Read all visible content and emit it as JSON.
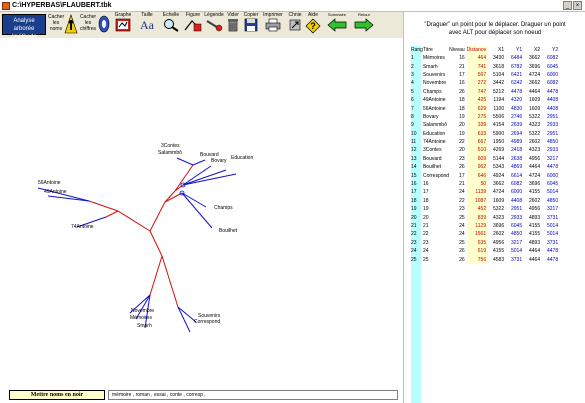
{
  "window": {
    "title": "C:\\HYPERBAS\\FLAUBERT.tbk"
  },
  "toolbar": {
    "analyse_label": "Analyse arborée (méthode Luong)",
    "cacher_noms": "Cacher les noms",
    "cacher_chiffres": "Cacher les chiffres",
    "graphe": "Graphe",
    "taille": "Taille",
    "taille_glyph": "Aa",
    "echelle": "Echelle",
    "figure": "Figure",
    "legende": "Légende",
    "vider": "Vider",
    "copier": "Copier",
    "imprimer": "Imprimer",
    "chnie": "Chnie",
    "aide": "Aide",
    "sommaire": "Sommaire",
    "retour": "Retour"
  },
  "instructions": {
    "line1": "\"Draguer\" un point pour le déplacer. Draguer un point",
    "line2": "avec ALT pour déplacer son noeud"
  },
  "table": {
    "headers": [
      "Rang",
      "Titre",
      "Niveau",
      "Distance",
      "X1",
      "Y1",
      "X2",
      "Y2"
    ],
    "rows": [
      [
        "1",
        "Mémoires",
        "16",
        "464",
        "3430",
        "6484",
        "3662",
        "6082"
      ],
      [
        "2",
        "Smarh",
        "21",
        "741",
        "3618",
        "6782",
        "3696",
        "6045"
      ],
      [
        "3",
        "Souvenirs",
        "17",
        "567",
        "5104",
        "6421",
        "4724",
        "6000"
      ],
      [
        "4",
        "Novembre",
        "16",
        "272",
        "3442",
        "6242",
        "3662",
        "6082"
      ],
      [
        "5",
        "Champs",
        "26",
        "747",
        "5212",
        "4478",
        "4464",
        "4478"
      ],
      [
        "6",
        "49Antoine",
        "18",
        "425",
        "1194",
        "4320",
        "1609",
        "4408"
      ],
      [
        "7",
        "56Antoine",
        "18",
        "629",
        "1100",
        "4830",
        "1609",
        "4408"
      ],
      [
        "8",
        "Bovary",
        "19",
        "275",
        "5506",
        "2746",
        "5322",
        "2951"
      ],
      [
        "9",
        "Salammbô",
        "20",
        "339",
        "4154",
        "2639",
        "4323",
        "2933"
      ],
      [
        "10",
        "Education",
        "19",
        "633",
        "5900",
        "2694",
        "5322",
        "2951"
      ],
      [
        "11",
        "74Antoine",
        "22",
        "667",
        "1950",
        "4989",
        "2602",
        "4850"
      ],
      [
        "12",
        "3Contes",
        "20",
        "510",
        "4269",
        "2418",
        "4323",
        "2933"
      ],
      [
        "13",
        "Bouvard",
        "23",
        "609",
        "5144",
        "2638",
        "4956",
        "3217"
      ],
      [
        "14",
        "Bouilhet",
        "26",
        "962",
        "5343",
        "4869",
        "4464",
        "4478"
      ],
      [
        "15",
        "Correspond",
        "17",
        "646",
        "4924",
        "6614",
        "4724",
        "6000"
      ],
      [
        "16",
        "16",
        "21",
        "50",
        "3662",
        "6082",
        "3696",
        "6045"
      ],
      [
        "17",
        "17",
        "24",
        "1139",
        "4724",
        "6000",
        "4155",
        "5014"
      ],
      [
        "18",
        "18",
        "22",
        "1087",
        "1609",
        "4408",
        "2602",
        "4850"
      ],
      [
        "19",
        "19",
        "23",
        "452",
        "5322",
        "2951",
        "4956",
        "3217"
      ],
      [
        "20",
        "20",
        "25",
        "839",
        "4323",
        "2933",
        "4893",
        "3731"
      ],
      [
        "21",
        "21",
        "24",
        "1129",
        "3696",
        "6045",
        "4155",
        "5014"
      ],
      [
        "22",
        "22",
        "24",
        "1561",
        "2602",
        "4850",
        "4155",
        "5014"
      ],
      [
        "23",
        "23",
        "25",
        "635",
        "4956",
        "3217",
        "4893",
        "3731"
      ],
      [
        "24",
        "24",
        "26",
        "619",
        "4155",
        "5014",
        "4464",
        "4478"
      ],
      [
        "25",
        "25",
        "26",
        "756",
        "4583",
        "3731",
        "4464",
        "4478"
      ]
    ]
  },
  "tree": {
    "labels": [
      "3Contes",
      "Salammbô",
      "Bouvard",
      "Bovary",
      "Education",
      "56Antoine",
      "49Antoine",
      "74Antoine",
      "Champs",
      "Bouilhet",
      "Novembre",
      "Mémoires",
      "Smarh",
      "Souvenirs",
      "Correspond"
    ]
  },
  "bottom": {
    "mettre_label": "Mettre noms en noir",
    "status": "mémoire , roman , essai , conte , corresp ,"
  },
  "colors": {
    "internal_edge": "#d01010",
    "leaf_edge": "#1010d0",
    "accent": "#1a3e8c"
  }
}
